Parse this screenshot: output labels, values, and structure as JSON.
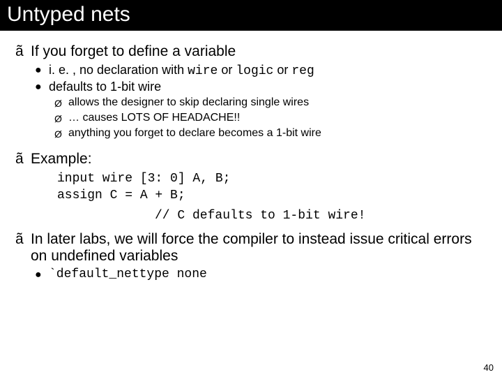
{
  "title": "Untyped nets",
  "bullets": {
    "b1": {
      "marker": "ã",
      "text": "If you forget to define a variable",
      "sub": [
        {
          "marker": "●",
          "pre": "i. e. , no declaration with ",
          "c1": "wire",
          "mid1": " or ",
          "c2": "logic",
          "mid2": " or ",
          "c3": "reg"
        },
        {
          "marker": "●",
          "text": "defaults to 1-bit wire"
        }
      ],
      "sub2": [
        {
          "marker": "Ø",
          "text": "allows the designer to skip declaring single wires"
        },
        {
          "marker": "Ø",
          "text": "… causes LOTS OF HEADACHE!!"
        },
        {
          "marker": "Ø",
          "text": "anything you forget to declare becomes a 1-bit wire"
        }
      ]
    },
    "b2": {
      "marker": "ã",
      "text": "Example:",
      "code_line1": "input wire [3: 0] A, B;",
      "code_line2": "assign C = A + B;",
      "comment": "// C defaults to 1-bit wire!"
    },
    "b3": {
      "marker": "ã",
      "text": "In later labs, we will force the compiler to instead issue critical errors on undefined variables",
      "sub": {
        "marker": "●",
        "code": "`default_nettype none"
      }
    }
  },
  "page_number": "40"
}
